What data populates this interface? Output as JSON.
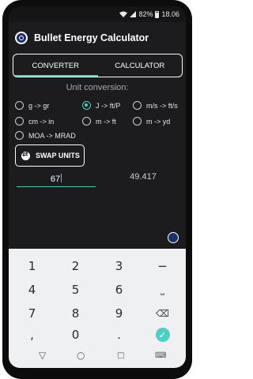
{
  "status_bar": {
    "battery": "82%",
    "time": "18.06"
  },
  "app": {
    "title": "Bullet Energy Calculator"
  },
  "tabs": [
    {
      "label": "CONVERTER",
      "active": true
    },
    {
      "label": "CALCULATOR",
      "active": false
    }
  ],
  "converter": {
    "section_label": "Unit conversion:",
    "options": [
      {
        "label": "g -> gr",
        "checked": false
      },
      {
        "label": "J -> ft/P",
        "checked": true
      },
      {
        "label": "m/s -> ft/s",
        "checked": false
      },
      {
        "label": "cm -> in",
        "checked": false
      },
      {
        "label": "m -> ft",
        "checked": false
      },
      {
        "label": "m -> yd",
        "checked": false
      },
      {
        "label": "MOA -> MRAD",
        "checked": false
      }
    ],
    "swap_label": "SWAP UNITS",
    "input_value": "67",
    "result_value": "49.417"
  },
  "keyboard": {
    "keys": [
      "1",
      "2",
      "3",
      "−",
      "4",
      "5",
      "6",
      "⎵",
      "7",
      "8",
      "9",
      "⌫",
      ",",
      "0",
      ".",
      "✓"
    ]
  },
  "navbar": [
    "back-icon",
    "home-icon",
    "recents-icon",
    "keyboard-icon"
  ],
  "colors": {
    "accent": "#4dd0c4",
    "background": "#1c1c1e"
  }
}
